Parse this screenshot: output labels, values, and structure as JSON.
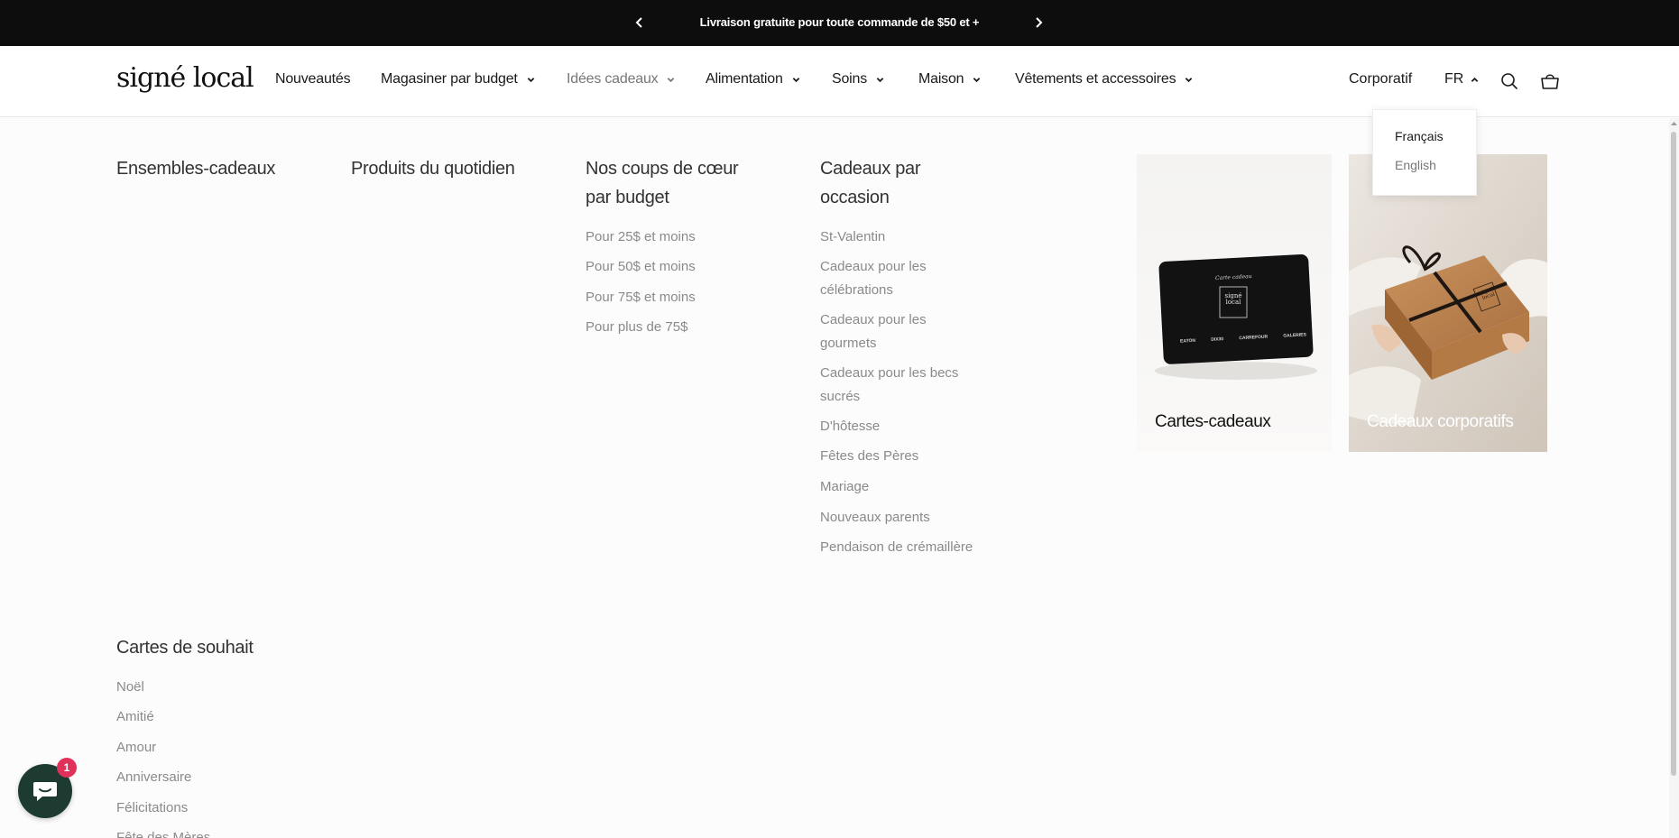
{
  "announcement": {
    "text": "Livraison gratuite pour toute commande de $50 et +",
    "prev_icon": "chevron-left-icon",
    "next_icon": "chevron-right-icon"
  },
  "header": {
    "logo": "signé local",
    "nav": [
      {
        "label": "Nouveautés",
        "has_dropdown": false
      },
      {
        "label": "Magasiner par budget",
        "has_dropdown": true
      },
      {
        "label": "Idées cadeaux",
        "has_dropdown": true,
        "active": true
      },
      {
        "label": "Alimentation",
        "has_dropdown": true
      },
      {
        "label": "Soins",
        "has_dropdown": true
      },
      {
        "label": "Maison",
        "has_dropdown": true
      },
      {
        "label": "Vêtements et accessoires",
        "has_dropdown": true
      }
    ],
    "corporate": "Corporatif",
    "language": "FR",
    "search_icon": "search-icon",
    "cart_icon": "cart-icon"
  },
  "language_menu": {
    "options": [
      "Français",
      "English"
    ]
  },
  "mega_menu": {
    "columns": [
      {
        "title": "Ensembles-cadeaux",
        "links": []
      },
      {
        "title": "Produits du quotidien",
        "links": []
      },
      {
        "title": "Nos coups de cœur par budget",
        "links": [
          "Pour 25$ et moins",
          "Pour 50$ et moins",
          "Pour 75$ et moins",
          "Pour plus de 75$"
        ]
      },
      {
        "title": "Cadeaux par occasion",
        "links": [
          "St-Valentin",
          "Cadeaux pour les célébrations",
          "Cadeaux pour les gourmets",
          "Cadeaux pour les becs sucrés",
          "D'hôtesse",
          "Fêtes des Pères",
          "Mariage",
          "Nouveaux parents",
          "Pendaison de crémaillère"
        ]
      },
      {
        "title": "Cartes de souhait",
        "links": [
          "Noël",
          "Amitié",
          "Amour",
          "Anniversaire",
          "Félicitations",
          "Fête des Mères"
        ]
      }
    ],
    "cards": [
      {
        "label": "Cartes-cadeaux"
      },
      {
        "label": "Cadeaux corporatifs"
      }
    ],
    "gift_card_text": {
      "script": "Carte cadeau",
      "logo_line1": "signé",
      "logo_line2": "local",
      "partners": [
        "EATON",
        "DIX30",
        "CARREFOUR",
        "GALERIES"
      ]
    },
    "box_logo": {
      "line1": "signé",
      "line2": "local"
    }
  },
  "chat": {
    "badge_count": "1",
    "icon": "chat-icon"
  },
  "colors": {
    "announcement_bg": "#0d0d0d",
    "chat_bg": "#1d3b31",
    "badge": "#e0315b"
  }
}
